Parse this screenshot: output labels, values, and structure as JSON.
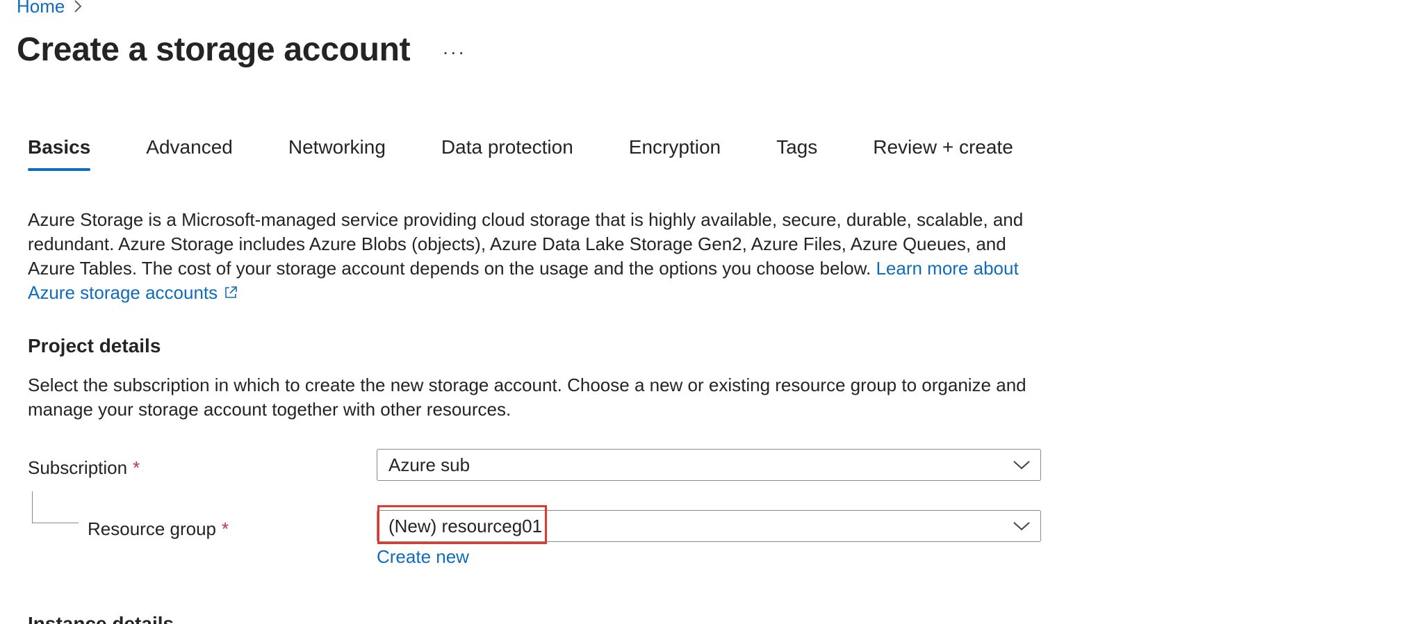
{
  "breadcrumb": {
    "home": "Home"
  },
  "page": {
    "title": "Create a storage account",
    "more": "···"
  },
  "tabs": [
    {
      "label": "Basics",
      "active": true
    },
    {
      "label": "Advanced"
    },
    {
      "label": "Networking"
    },
    {
      "label": "Data protection"
    },
    {
      "label": "Encryption"
    },
    {
      "label": "Tags"
    },
    {
      "label": "Review + create"
    }
  ],
  "intro": {
    "text": "Azure Storage is a Microsoft-managed service providing cloud storage that is highly available, secure, durable, scalable, and redundant. Azure Storage includes Azure Blobs (objects), Azure Data Lake Storage Gen2, Azure Files, Azure Queues, and Azure Tables. The cost of your storage account depends on the usage and the options you choose below. ",
    "link": "Learn more about Azure storage accounts"
  },
  "project_details": {
    "title": "Project details",
    "description": "Select the subscription in which to create the new storage account. Choose a new or existing resource group to organize and manage your storage account together with other resources.",
    "subscription": {
      "label": "Subscription",
      "required": "*",
      "value": "Azure sub"
    },
    "resource_group": {
      "label": "Resource group",
      "required": "*",
      "value": "(New) resourceg01",
      "create_new": "Create new"
    }
  },
  "next_section": {
    "title": "Instance details"
  },
  "colors": {
    "link": "#0f6cbd",
    "required": "#c4314b",
    "highlight": "#e0392b",
    "border": "#8a8886"
  },
  "icons": {
    "breadcrumb_sep": "chevron-right-icon",
    "external": "external-link-icon",
    "dropdown": "chevron-down-icon"
  }
}
